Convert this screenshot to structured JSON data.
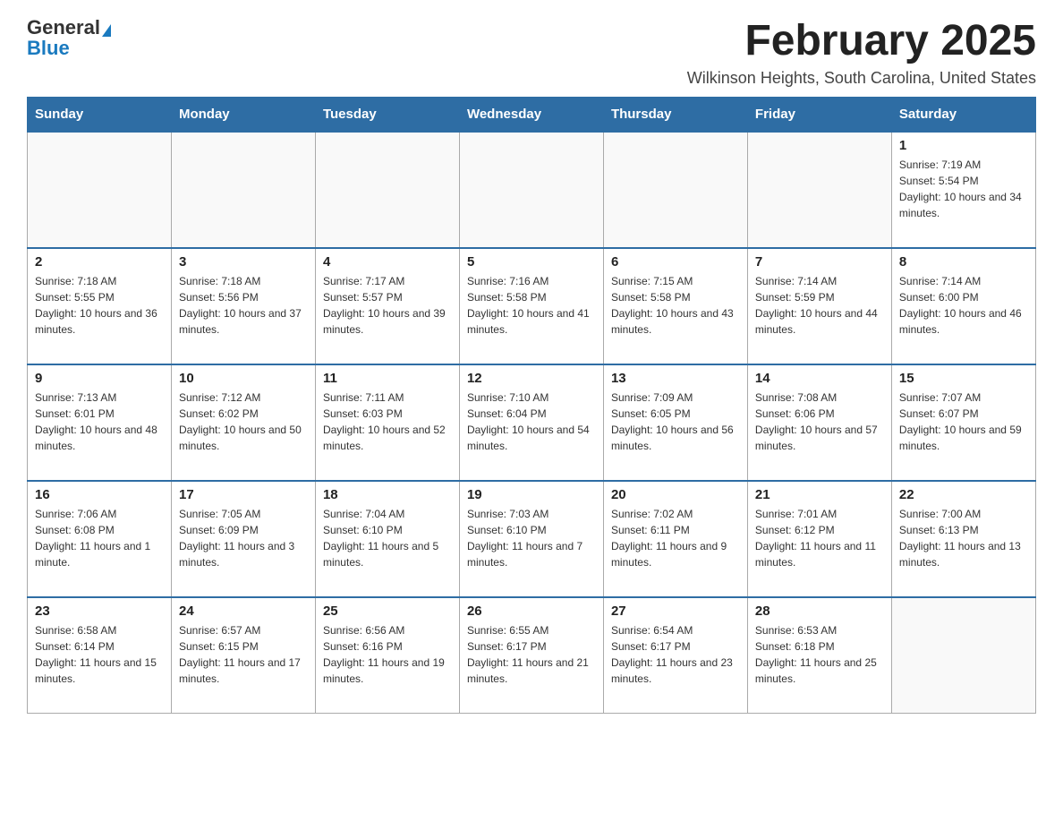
{
  "header": {
    "logo_general": "General",
    "logo_blue": "Blue",
    "month_title": "February 2025",
    "location": "Wilkinson Heights, South Carolina, United States"
  },
  "days_of_week": [
    "Sunday",
    "Monday",
    "Tuesday",
    "Wednesday",
    "Thursday",
    "Friday",
    "Saturday"
  ],
  "weeks": [
    [
      {
        "day": "",
        "info": ""
      },
      {
        "day": "",
        "info": ""
      },
      {
        "day": "",
        "info": ""
      },
      {
        "day": "",
        "info": ""
      },
      {
        "day": "",
        "info": ""
      },
      {
        "day": "",
        "info": ""
      },
      {
        "day": "1",
        "info": "Sunrise: 7:19 AM\nSunset: 5:54 PM\nDaylight: 10 hours and 34 minutes."
      }
    ],
    [
      {
        "day": "2",
        "info": "Sunrise: 7:18 AM\nSunset: 5:55 PM\nDaylight: 10 hours and 36 minutes."
      },
      {
        "day": "3",
        "info": "Sunrise: 7:18 AM\nSunset: 5:56 PM\nDaylight: 10 hours and 37 minutes."
      },
      {
        "day": "4",
        "info": "Sunrise: 7:17 AM\nSunset: 5:57 PM\nDaylight: 10 hours and 39 minutes."
      },
      {
        "day": "5",
        "info": "Sunrise: 7:16 AM\nSunset: 5:58 PM\nDaylight: 10 hours and 41 minutes."
      },
      {
        "day": "6",
        "info": "Sunrise: 7:15 AM\nSunset: 5:58 PM\nDaylight: 10 hours and 43 minutes."
      },
      {
        "day": "7",
        "info": "Sunrise: 7:14 AM\nSunset: 5:59 PM\nDaylight: 10 hours and 44 minutes."
      },
      {
        "day": "8",
        "info": "Sunrise: 7:14 AM\nSunset: 6:00 PM\nDaylight: 10 hours and 46 minutes."
      }
    ],
    [
      {
        "day": "9",
        "info": "Sunrise: 7:13 AM\nSunset: 6:01 PM\nDaylight: 10 hours and 48 minutes."
      },
      {
        "day": "10",
        "info": "Sunrise: 7:12 AM\nSunset: 6:02 PM\nDaylight: 10 hours and 50 minutes."
      },
      {
        "day": "11",
        "info": "Sunrise: 7:11 AM\nSunset: 6:03 PM\nDaylight: 10 hours and 52 minutes."
      },
      {
        "day": "12",
        "info": "Sunrise: 7:10 AM\nSunset: 6:04 PM\nDaylight: 10 hours and 54 minutes."
      },
      {
        "day": "13",
        "info": "Sunrise: 7:09 AM\nSunset: 6:05 PM\nDaylight: 10 hours and 56 minutes."
      },
      {
        "day": "14",
        "info": "Sunrise: 7:08 AM\nSunset: 6:06 PM\nDaylight: 10 hours and 57 minutes."
      },
      {
        "day": "15",
        "info": "Sunrise: 7:07 AM\nSunset: 6:07 PM\nDaylight: 10 hours and 59 minutes."
      }
    ],
    [
      {
        "day": "16",
        "info": "Sunrise: 7:06 AM\nSunset: 6:08 PM\nDaylight: 11 hours and 1 minute."
      },
      {
        "day": "17",
        "info": "Sunrise: 7:05 AM\nSunset: 6:09 PM\nDaylight: 11 hours and 3 minutes."
      },
      {
        "day": "18",
        "info": "Sunrise: 7:04 AM\nSunset: 6:10 PM\nDaylight: 11 hours and 5 minutes."
      },
      {
        "day": "19",
        "info": "Sunrise: 7:03 AM\nSunset: 6:10 PM\nDaylight: 11 hours and 7 minutes."
      },
      {
        "day": "20",
        "info": "Sunrise: 7:02 AM\nSunset: 6:11 PM\nDaylight: 11 hours and 9 minutes."
      },
      {
        "day": "21",
        "info": "Sunrise: 7:01 AM\nSunset: 6:12 PM\nDaylight: 11 hours and 11 minutes."
      },
      {
        "day": "22",
        "info": "Sunrise: 7:00 AM\nSunset: 6:13 PM\nDaylight: 11 hours and 13 minutes."
      }
    ],
    [
      {
        "day": "23",
        "info": "Sunrise: 6:58 AM\nSunset: 6:14 PM\nDaylight: 11 hours and 15 minutes."
      },
      {
        "day": "24",
        "info": "Sunrise: 6:57 AM\nSunset: 6:15 PM\nDaylight: 11 hours and 17 minutes."
      },
      {
        "day": "25",
        "info": "Sunrise: 6:56 AM\nSunset: 6:16 PM\nDaylight: 11 hours and 19 minutes."
      },
      {
        "day": "26",
        "info": "Sunrise: 6:55 AM\nSunset: 6:17 PM\nDaylight: 11 hours and 21 minutes."
      },
      {
        "day": "27",
        "info": "Sunrise: 6:54 AM\nSunset: 6:17 PM\nDaylight: 11 hours and 23 minutes."
      },
      {
        "day": "28",
        "info": "Sunrise: 6:53 AM\nSunset: 6:18 PM\nDaylight: 11 hours and 25 minutes."
      },
      {
        "day": "",
        "info": ""
      }
    ]
  ]
}
